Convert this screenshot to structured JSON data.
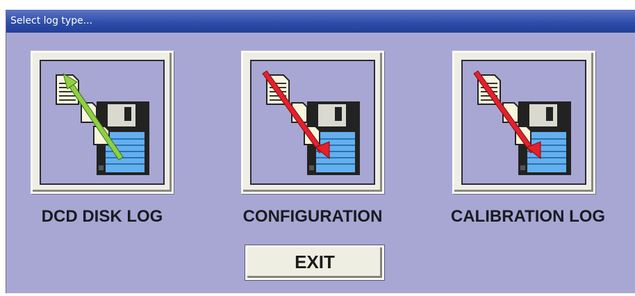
{
  "window": {
    "title": "Select log type..."
  },
  "options": [
    {
      "label": "DCD DISK LOG",
      "icon": "document-to-disk-icon",
      "arrow_color": "#8ed042"
    },
    {
      "label": "CONFIGURATION",
      "icon": "document-to-disk-icon",
      "arrow_color": "#e5202a"
    },
    {
      "label": "CALIBRATION LOG",
      "icon": "document-to-disk-icon",
      "arrow_color": "#e5202a"
    }
  ],
  "exit_button": {
    "label": "EXIT"
  },
  "colors": {
    "background": "#a8a7d3",
    "titlebar": "#2f4ea9",
    "disk_label": "#63b0ef",
    "disk_body": "#222222"
  }
}
